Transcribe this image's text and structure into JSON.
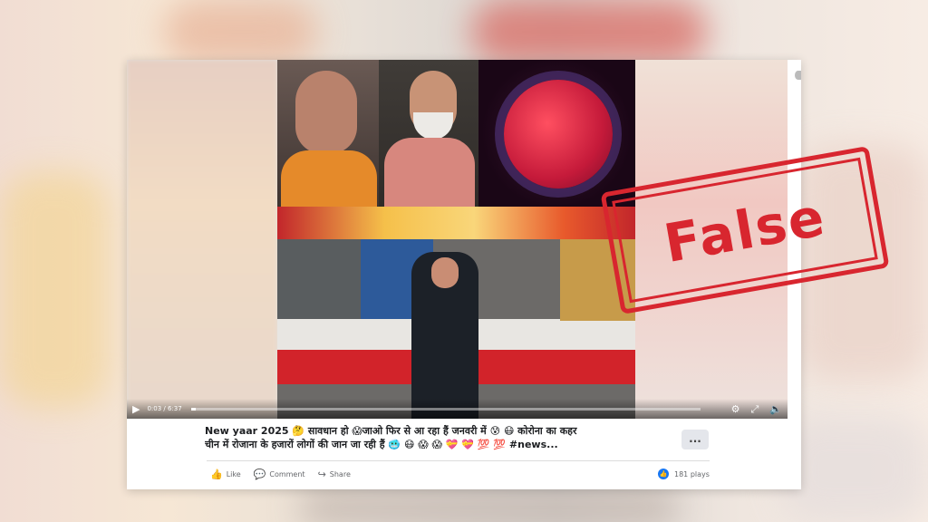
{
  "video": {
    "time": "0:03 / 6:37",
    "progress": 0.01
  },
  "caption": {
    "line1": "New yaar 2025 🤔 सावधान हो 😱जाओ फिर से आ रहा हैं जनवरी में 😰 😷 कोरोना का कहर",
    "line2": "चीन में रोजाना के हजारों लोगों की जान जा रही हैं 🥶 😷 😱 😱 💝 💝 💯 💯 #news..."
  },
  "more_label": "...",
  "actions": {
    "like": "Like",
    "comment": "Comment",
    "share": "Share"
  },
  "plays": "181 plays",
  "stamp": "False",
  "colors": {
    "stamp_red": "#d8262f",
    "facebook_blue": "#1877f2"
  },
  "icons": {
    "play": "play-icon",
    "settings": "gear-icon",
    "fullscreen": "fullscreen-icon",
    "volume": "volume-icon",
    "like": "thumbs-up-icon",
    "comment": "comment-icon",
    "share": "share-icon"
  }
}
